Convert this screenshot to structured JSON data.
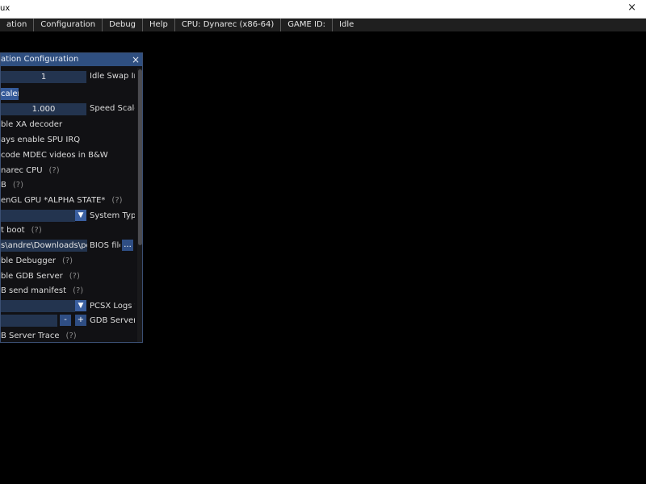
{
  "window": {
    "title": "ux",
    "close_glyph": "×"
  },
  "menubar": {
    "items": [
      {
        "label": "ation"
      },
      {
        "label": "Configuration"
      },
      {
        "label": "Debug"
      },
      {
        "label": "Help"
      },
      {
        "label": "CPU: Dynarec (x86-64)"
      },
      {
        "label": "GAME ID:"
      },
      {
        "label": "Idle"
      }
    ]
  },
  "config_window": {
    "title": "ation Configuration",
    "close_glyph": "×",
    "idle_swap": {
      "value": "1",
      "label": "Idle Swap Inte"
    },
    "speed_scaler_button": "caler",
    "speed_scaler": {
      "value": "1.000",
      "label": "Speed Scaler"
    },
    "options": [
      {
        "text": "ble XA decoder"
      },
      {
        "text": "ays enable SPU IRQ"
      },
      {
        "text": "code MDEC videos in B&W"
      },
      {
        "text": "narec CPU",
        "help": "(?)"
      },
      {
        "text": "B",
        "help": "(?)"
      },
      {
        "text": "enGL GPU *ALPHA STATE*",
        "help": "(?)"
      }
    ],
    "system_type": {
      "label": "System Type",
      "arrow": "▼"
    },
    "fast_boot": {
      "text": "t boot",
      "help": "(?)"
    },
    "bios_file": {
      "value": "s\\andre\\Downloads\\pcsx-re",
      "label": "BIOS file",
      "browse": "..."
    },
    "debugger": {
      "text": "ble Debugger",
      "help": "(?)"
    },
    "gdb_server": {
      "text": "ble GDB Server",
      "help": "(?)"
    },
    "gdb_manifest": {
      "text": "B send manifest",
      "help": "(?)"
    },
    "pcsx_logs": {
      "label": "PCSX Logs to ",
      "arrow": "▼"
    },
    "gdb_port": {
      "label": "GDB Server P",
      "minus": "-",
      "plus": "+"
    },
    "gdb_trace": {
      "text": "B Server Trace",
      "help": "(?)"
    }
  }
}
